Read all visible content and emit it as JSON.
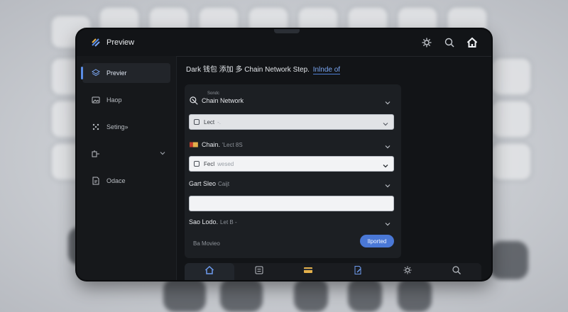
{
  "window": {
    "title": "Preview"
  },
  "topbar": {
    "icons": [
      "settings-icon",
      "search-icon",
      "home-icon"
    ]
  },
  "sidebar": {
    "items": [
      {
        "label": "Previer",
        "icon": "layers-icon",
        "active": true
      },
      {
        "label": "Haop",
        "icon": "image-icon",
        "active": false
      },
      {
        "label": "Seting»",
        "icon": "grid-icon",
        "active": false
      },
      {
        "label": "",
        "icon": "network-icon",
        "active": false,
        "has_chevron": true
      },
      {
        "label": "Odace",
        "icon": "doc-icon",
        "active": false
      }
    ]
  },
  "main": {
    "title_text": "Dark 钱包 添加 多 Chain Network Step.",
    "title_link": "Inlnde of"
  },
  "sections": {
    "chain_network": {
      "small": "Sondc",
      "label": "Chain Network"
    },
    "field1": {
      "value": "Lect",
      "placeholder": "-."
    },
    "chain2": {
      "label": "Chain.",
      "muted": "'Lect 8S"
    },
    "field2": {
      "value": "Fecl",
      "placeholder": "wesed"
    },
    "gart": {
      "label": "Gart Sleo",
      "muted": "Caijt"
    },
    "field3": {
      "value": ""
    },
    "sao": {
      "label": "Sao Lodo.",
      "muted": "Let B -"
    }
  },
  "footer": {
    "label": "Ba Movieo",
    "button": "Ilported"
  },
  "tabbar": {
    "tabs": [
      "home-icon",
      "list-icon",
      "folder-icon",
      "doc-edit-icon",
      "settings-icon",
      "search-icon"
    ]
  },
  "colors": {
    "accent": "#4a78d6",
    "background": "#121417",
    "panel": "#1c1f23"
  }
}
